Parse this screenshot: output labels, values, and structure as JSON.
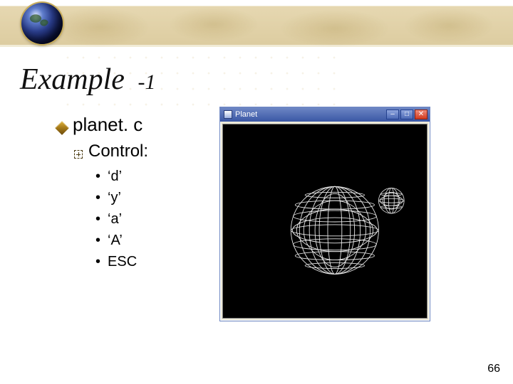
{
  "title_main": "Example",
  "title_sub": "-1",
  "item1": "planet. c",
  "item2": "Control:",
  "controls": {
    "k0": "‘d’",
    "k1": "‘y’",
    "k2": "‘a’",
    "k3": "‘A’",
    "k4": "ESC"
  },
  "planet_window": {
    "title": "Planet",
    "min_glyph": "–",
    "max_glyph": "□",
    "close_glyph": "✕"
  },
  "page_number": "66"
}
